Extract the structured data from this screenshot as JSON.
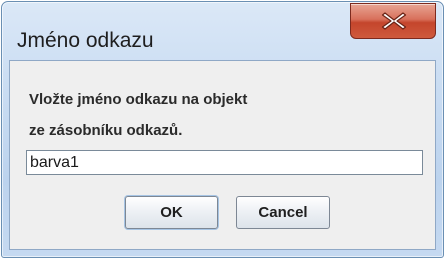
{
  "window": {
    "title": "Jméno odkazu",
    "close_icon": "close-x-icon"
  },
  "dialog": {
    "message_line1": "Vložte jméno odkazu na objekt",
    "message_line2": "ze zásobníku odkazů.",
    "input_value": "barva1",
    "ok_label": "OK",
    "cancel_label": "Cancel"
  },
  "colors": {
    "close_button": "#c4452c",
    "dialog_background": "#efefef",
    "frame": "#bcd3ee"
  }
}
